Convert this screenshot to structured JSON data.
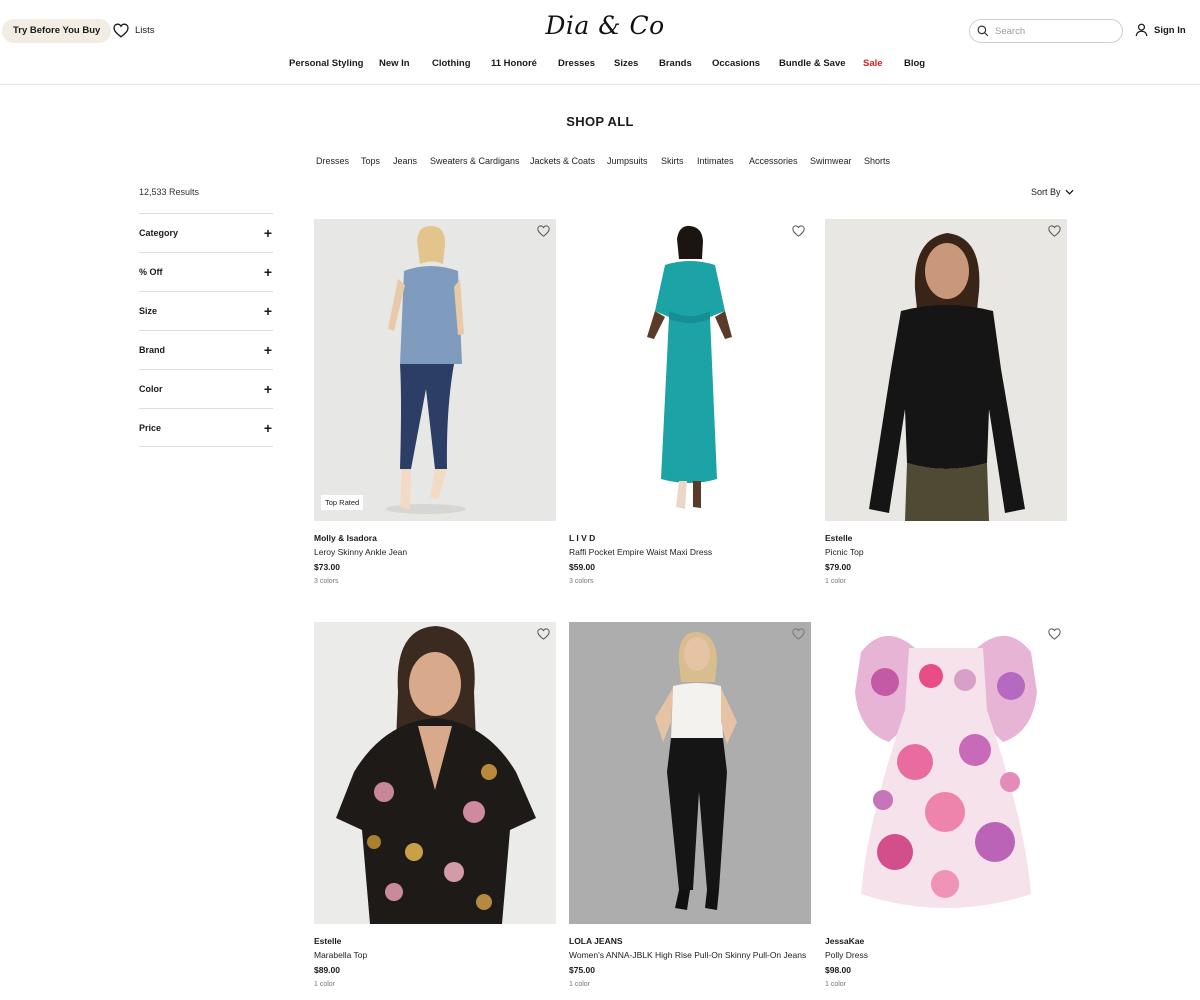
{
  "header": {
    "try_label": "Try Before You Buy",
    "lists_label": "Lists",
    "logo_text": "Dia & Co",
    "search_placeholder": "Search",
    "signin_label": "Sign In"
  },
  "nav": {
    "items": [
      "Personal Styling",
      "New In",
      "Clothing",
      "11 Honoré",
      "Dresses",
      "Sizes",
      "Brands",
      "Occasions",
      "Bundle & Save",
      "Sale",
      "Blog"
    ],
    "sale_color": "#d32027"
  },
  "page_title": "SHOP ALL",
  "subcategories": [
    "Dresses",
    "Tops",
    "Jeans",
    "Sweaters & Cardigans",
    "Jackets & Coats",
    "Jumpsuits",
    "Skirts",
    "Intimates",
    "Accessories",
    "Swimwear",
    "Shorts"
  ],
  "results_count": "12,533 Results",
  "sort_label": "Sort By",
  "filters": [
    "Category",
    "% Off",
    "Size",
    "Brand",
    "Color",
    "Price"
  ],
  "products": [
    {
      "brand": "Molly & Isadora",
      "name": "Leroy Skinny Ankle Jean",
      "price": "$73.00",
      "colors": "3 colors",
      "badge": "Top Rated"
    },
    {
      "brand": "L I V D",
      "name": "Raffi Pocket Empire Waist Maxi Dress",
      "price": "$59.00",
      "colors": "3 colors"
    },
    {
      "brand": "Estelle",
      "name": "Picnic Top",
      "price": "$79.00",
      "colors": "1 color"
    },
    {
      "brand": "Estelle",
      "name": "Marabella Top",
      "price": "$89.00",
      "colors": "1 color"
    },
    {
      "brand": "LOLA JEANS",
      "name": "Women's ANNA-JBLK High Rise Pull-On Skinny Pull-On Jeans",
      "price": "$75.00",
      "colors": "1 color"
    },
    {
      "brand": "JessaKae",
      "name": "Polly Dress",
      "price": "$98.00",
      "colors": "1 color"
    }
  ],
  "icons": {
    "heart": "heart-icon",
    "search": "search-icon",
    "user": "user-icon",
    "chevron": "chevron-down-icon",
    "plus": "plus-icon"
  }
}
